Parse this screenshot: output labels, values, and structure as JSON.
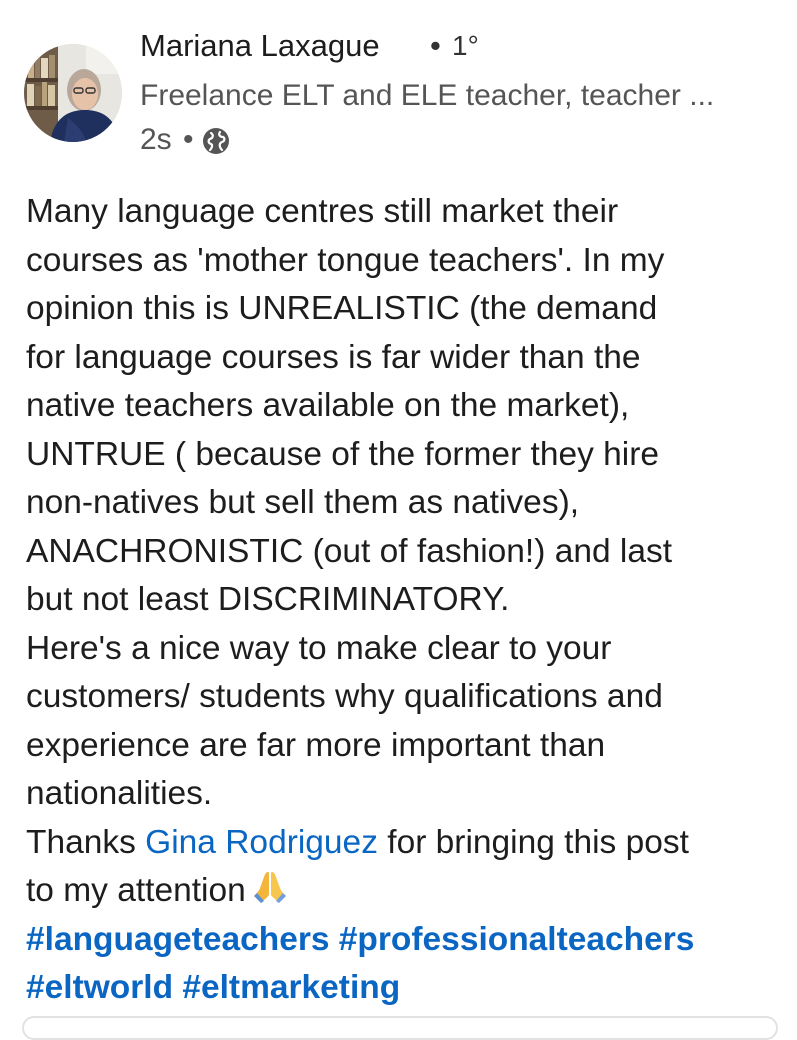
{
  "post": {
    "author": {
      "name": "Mariana Laxague",
      "separator": "•",
      "connection_degree": "1°",
      "headline": "Freelance ELT and ELE teacher, teacher ..."
    },
    "meta": {
      "time_ago": "2s",
      "separator": "•",
      "visibility_icon": "globe-icon"
    },
    "body": {
      "lines": [
        "Many language centres still market their",
        "courses as 'mother tongue teachers'. In my",
        "opinion this is UNREALISTIC (the demand",
        "for language courses is far wider than the",
        "native teachers available on the market),",
        "UNTRUE ( because of the former they hire",
        "non-natives but sell them as natives),",
        "ANACHRONISTIC (out of fashion!) and last",
        "but not least DISCRIMINATORY.",
        "Here's a nice way to make clear to your",
        "customers/ students why qualifications and",
        "experience are far more important than",
        "nationalities."
      ],
      "thanks_prefix": "Thanks ",
      "mention": "Gina Rodriguez",
      "thanks_suffix": " for bringing this post",
      "attention_line": "to my attention",
      "attention_emoji_icon": "folded-hands-icon",
      "hashtags_line_1": "#languageteachers #professionalteachers",
      "hashtags_line_2": "#eltworld #eltmarketing"
    }
  },
  "colors": {
    "link": "#0a66c2",
    "text": "#1d1d1d",
    "secondary_text": "#555555"
  }
}
